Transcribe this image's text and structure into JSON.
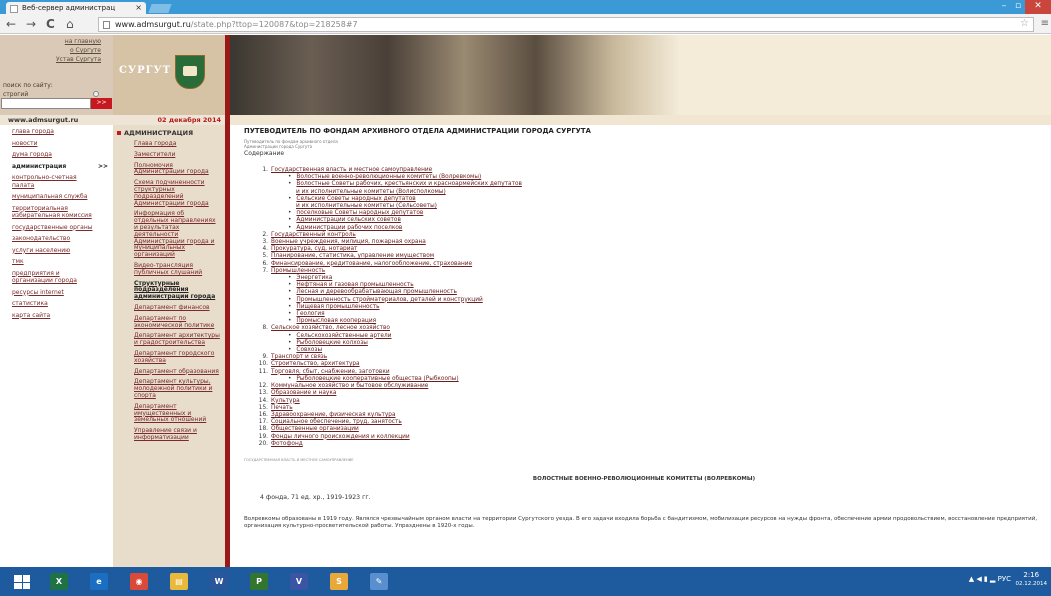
{
  "browser": {
    "tab_title": "Веб-сервер администрац",
    "tab_close": "×",
    "url_prefix": "www.admsurgut.ru",
    "url_rest": "/state.php?ttop=120087&top=218258#7",
    "back": "←",
    "forward": "→",
    "reload": "C",
    "home": "⌂",
    "star": "☆",
    "menu": "≡"
  },
  "header": {
    "top_links": [
      "на главную",
      "о Сургуте",
      "Устав Сургута"
    ],
    "search_label": "поиск по сайту:",
    "search_mode": "строгий",
    "search_button": ">>",
    "logo": "СУРГУТ",
    "site_name": "www.admsurgut.ru",
    "date": "02 декабря 2014"
  },
  "left_nav": [
    {
      "label": "глава города",
      "bold": false
    },
    {
      "label": "новости",
      "bold": false
    },
    {
      "label": "дума города",
      "bold": false
    },
    {
      "label": "администрация",
      "bold": true
    },
    {
      "label": "контрольно-счетная палата",
      "bold": false
    },
    {
      "label": "муниципальная служба",
      "bold": false
    },
    {
      "label": "территориальная избирательная комиссия",
      "bold": false
    },
    {
      "label": "государственные органы",
      "bold": false
    },
    {
      "label": "законодательство",
      "bold": false
    },
    {
      "label": "услуги населению",
      "bold": false
    },
    {
      "label": "тмк",
      "bold": false
    },
    {
      "label": "предприятия и организации города",
      "bold": false
    },
    {
      "label": "ресурсы internet",
      "bold": false
    },
    {
      "label": "статистика",
      "bold": false
    },
    {
      "label": "карта сайта",
      "bold": false
    }
  ],
  "mid_nav": {
    "heading": "АДМИНИСТРАЦИЯ",
    "items": [
      {
        "label": "Глава города",
        "bold": false
      },
      {
        "label": "Заместители",
        "bold": false
      },
      {
        "label": "Полномочия Администрации города",
        "bold": false
      },
      {
        "label": "Схема подчиненности структурных подразделений Администрации города",
        "bold": false
      },
      {
        "label": "Информация об отдельных направлениях и результатах деятельности Администрации города и муниципальных организаций",
        "bold": false
      },
      {
        "label": "Видео-трансляция публичных слушаний",
        "bold": false
      },
      {
        "label": "Структурные подразделения администрации города",
        "bold": true
      },
      {
        "label": "Департамент финансов",
        "bold": false
      },
      {
        "label": "Департамент по экономической политике",
        "bold": false
      },
      {
        "label": "Департамент архитектуры и градостроительства",
        "bold": false
      },
      {
        "label": "Департамент городского хозяйства",
        "bold": false
      },
      {
        "label": "Департамент образования",
        "bold": false
      },
      {
        "label": "Департамент культуры, молодежной политики и спорта",
        "bold": false
      },
      {
        "label": "Департамент имущественных и земельных отношений",
        "bold": false
      },
      {
        "label": "Управление связи и информатизации",
        "bold": false
      }
    ]
  },
  "content": {
    "title": "ПУТЕВОДИТЕЛЬ ПО ФОНДАМ АРХИВНОГО ОТДЕЛА АДМИНИСТРАЦИИ ГОРОДА СУРГУТА",
    "subtitle_1": "Путеводитель по фондам архивного отдела",
    "subtitle_2": "Администрации города Сургута",
    "toc_heading": "Содержание",
    "toc": [
      {
        "type": "main",
        "num": "1.",
        "text": "Государственная власть и местное самоуправление"
      },
      {
        "type": "sub",
        "text": "Волостные военно-революционные комитеты (Волревкомы)"
      },
      {
        "type": "sub",
        "text": "Волостные Советы рабочих, крестьянских и красноармейских депутатов"
      },
      {
        "type": "cont",
        "text": "и их исполнительные комитеты (Волисполкомы)"
      },
      {
        "type": "sub",
        "text": "Сельские Советы народных депутатов"
      },
      {
        "type": "cont",
        "text": "и их исполнительные комитеты (Сельсоветы)"
      },
      {
        "type": "sub",
        "text": "поселковые Советы народных депутатов"
      },
      {
        "type": "sub",
        "text": "Администрации сельских советов"
      },
      {
        "type": "sub",
        "text": "Администрации рабочих поселков"
      },
      {
        "type": "main",
        "num": "2.",
        "text": "Государственный контроль"
      },
      {
        "type": "main",
        "num": "3.",
        "text": "Военные учреждения, милиция, пожарная охрана"
      },
      {
        "type": "main",
        "num": "4.",
        "text": "Прокуратура, суд, нотариат"
      },
      {
        "type": "main",
        "num": "5.",
        "text": "Планирование, статистика, управление имуществом"
      },
      {
        "type": "main",
        "num": "6.",
        "text": "Финансирование, кредитование, налогообложение, страхование"
      },
      {
        "type": "main",
        "num": "7.",
        "text": "Промышленность"
      },
      {
        "type": "sub",
        "text": "Энергетика"
      },
      {
        "type": "sub",
        "text": "Нефтяная и газовая промышленность"
      },
      {
        "type": "sub",
        "text": "Лесная и деревообрабатывающая промышленность"
      },
      {
        "type": "sub",
        "text": "Промышленность стройматериалов, деталей и конструкций"
      },
      {
        "type": "sub",
        "text": "Пищевая промышленность"
      },
      {
        "type": "sub",
        "text": "Геология"
      },
      {
        "type": "sub",
        "text": "Промысловая кооперация"
      },
      {
        "type": "main",
        "num": "8.",
        "text": "Сельское хозяйство, лесное хозяйство"
      },
      {
        "type": "sub",
        "text": "Сельскохозяйственные артели"
      },
      {
        "type": "sub",
        "text": "Рыболовецкие колхозы"
      },
      {
        "type": "sub",
        "text": "Совхозы"
      },
      {
        "type": "main",
        "num": "9.",
        "text": "Транспорт и связь"
      },
      {
        "type": "main",
        "num": "10.",
        "text": "Строительство, архитектура"
      },
      {
        "type": "main",
        "num": "11.",
        "text": "Торговля, сбыт, снабжение, заготовки"
      },
      {
        "type": "sub",
        "text": "Рыболовецкие кооперативные общества (Рыбкоопы)"
      },
      {
        "type": "main",
        "num": "12.",
        "text": "Коммунальное хозяйство и бытовое обслуживание"
      },
      {
        "type": "main",
        "num": "13.",
        "text": "Образование и наука"
      },
      {
        "type": "main",
        "num": "14.",
        "text": "Культура"
      },
      {
        "type": "main",
        "num": "15.",
        "text": "Печать"
      },
      {
        "type": "main",
        "num": "16.",
        "text": "Здравоохранение, физическая культура"
      },
      {
        "type": "main",
        "num": "17.",
        "text": "Социальное обеспечение, труд, занятость"
      },
      {
        "type": "main",
        "num": "18.",
        "text": "Общественные организации"
      },
      {
        "type": "main",
        "num": "19.",
        "text": "Фонды личного происхождения и коллекции"
      },
      {
        "type": "main",
        "num": "20.",
        "text": "Фотофонд"
      }
    ],
    "separator_note": "ГОСУДАРСТВЕННАЯ ВЛАСТЬ И МЕСТНОЕ САМОУПРАВЛЕНИЕ",
    "section_title": "ВОЛОСТНЫЕ ВОЕННО-РЕВОЛЮЦИОННЫЕ КОМИТЕТЫ (ВОЛРЕВКОМЫ)",
    "fondy": "4 фонда, 71 ед. хр., 1919-1923 гг.",
    "description": "Волревкомы образованы в 1919 году. Являлся чрезвычайным органом власти на территории Сургутского уезда. В его задачи входила борьба с бандитизмом, мобилизация ресурсов на нужды фронта, обеспечение армии продовольствием, восстановление предприятий, организация культурно-просветительской работы. Упразднены в 1920-х годы."
  },
  "taskbar": {
    "apps": [
      {
        "icon": "excel-icon",
        "letter": "X",
        "color": "#1f7244"
      },
      {
        "icon": "ie-icon",
        "letter": "e",
        "color": "#1b6fc2"
      },
      {
        "icon": "chrome-icon",
        "letter": "◉",
        "color": "#d94a38"
      },
      {
        "icon": "explorer-icon",
        "letter": "▤",
        "color": "#e8b93a"
      },
      {
        "icon": "word-icon",
        "letter": "W",
        "color": "#2b579a"
      },
      {
        "icon": "project-icon",
        "letter": "P",
        "color": "#31752f"
      },
      {
        "icon": "visio-icon",
        "letter": "V",
        "color": "#3955a3"
      },
      {
        "icon": "skype-icon",
        "letter": "S",
        "color": "#e9a93a"
      },
      {
        "icon": "paint-icon",
        "letter": "✎",
        "color": "#5a8fcf"
      }
    ],
    "tray_lang": "РУС",
    "clock_time": "2:16",
    "clock_date": "02.12.2014"
  }
}
